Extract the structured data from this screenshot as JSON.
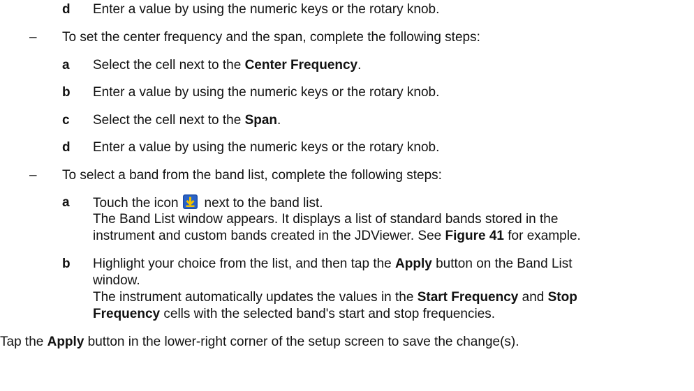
{
  "dash": "–",
  "block1": {
    "step_d": {
      "letter": "d",
      "text": "Enter a value by using the numeric keys or the rotary knob."
    }
  },
  "block2": {
    "intro": "To set the center frequency and the span, complete the following steps:",
    "step_a": {
      "letter": "a",
      "pre": "Select the cell next to the ",
      "bold": "Center Frequency",
      "post": "."
    },
    "step_b": {
      "letter": "b",
      "text": "Enter a value by using the numeric keys or the rotary knob."
    },
    "step_c": {
      "letter": "c",
      "pre": "Select the cell next to the ",
      "bold": "Span",
      "post": "."
    },
    "step_d": {
      "letter": "d",
      "text": "Enter a value by using the numeric keys or the rotary knob."
    }
  },
  "block3": {
    "intro": "To select a band from the band list, complete the following steps:",
    "step_a": {
      "letter": "a",
      "pre": "Touch the icon",
      "icon": "download-arrow-icon",
      "post": "next to the band list.",
      "line2": "The Band List window appears. It displays a list of standard bands stored in the",
      "line3_pre": "instrument and custom bands created in the JDViewer. See ",
      "line3_bold": "Figure 41",
      "line3_post": " for example."
    },
    "step_b": {
      "letter": "b",
      "line1_pre": "Highlight your choice from the list, and then tap the ",
      "line1_bold": "Apply",
      "line1_post": " button on the Band List",
      "line2": "window.",
      "line3": "The instrument automatically updates the values in the ",
      "line3_bold1": "Start Frequency",
      "line3_mid": " and ",
      "line3_bold2": "Stop",
      "line4_bold": "Frequency",
      "line4_post": " cells with the selected band's start and stop frequencies."
    }
  },
  "final": {
    "pre": "Tap the ",
    "bold": "Apply",
    "post": " button in the lower-right corner of the setup screen to save the change(s)."
  },
  "colors": {
    "icon_blue": "#1e4fa8",
    "icon_yellow": "#f2c200"
  }
}
